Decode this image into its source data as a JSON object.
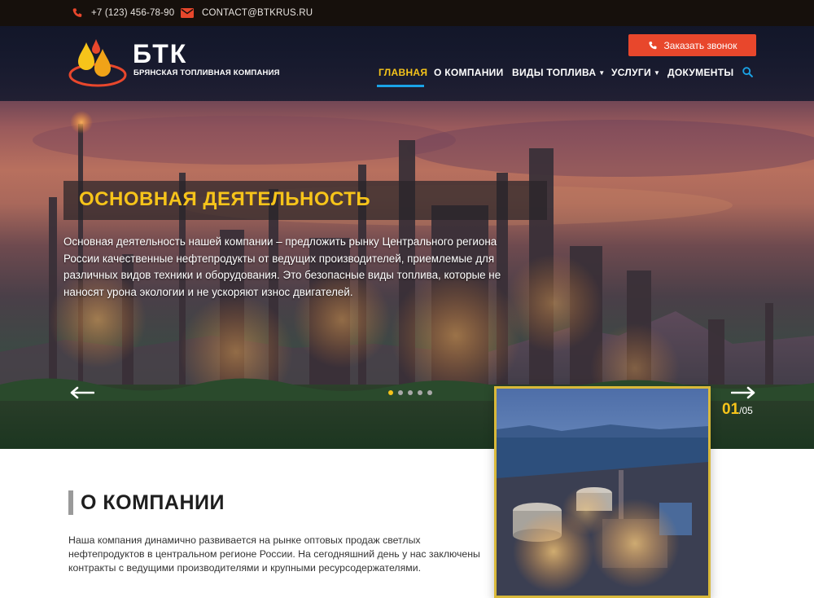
{
  "topbar": {
    "phone": "+7 (123) 456-78-90",
    "email": "CONTACT@BTKRUS.RU",
    "phone_icon": "phone-icon",
    "email_icon": "envelope-icon"
  },
  "header": {
    "logo_title": "БТК",
    "logo_subtitle": "Брянская топливная компания",
    "call_button": "Заказать звонок",
    "nav": [
      {
        "label": "ГЛАВНАЯ",
        "active": true
      },
      {
        "label": "О КОМПАНИИ"
      },
      {
        "label": "ВИДЫ ТОПЛИВА",
        "dropdown": true
      },
      {
        "label": "УСЛУГИ",
        "dropdown": true
      },
      {
        "label": "ДОКУМЕНТЫ"
      }
    ],
    "search_icon": "search-icon"
  },
  "slider": {
    "title": "ОСНОВНАЯ ДЕЯТЕЛЬНОСТЬ",
    "text": "Основная деятельность нашей компании – предложить рынку Центрального региона России качественные нефтепродукты от ведущих производителей, приемлемые для различных видов техники и оборудования. Это безопасные виды топлива, которые не наносят урона экологии и не ускоряют износ двигателей.",
    "current": "01",
    "total": "/05",
    "active_dot": 1,
    "dot_count": 5
  },
  "about": {
    "title": "О КОМПАНИИ",
    "text": "Наша компания динамично развивается на рынке оптовых продаж светлых нефтепродуктов в центральном регионе России. На сегодняшний день у нас заключены контракты с ведущими производителями и крупными ресурсодержателями."
  },
  "colors": {
    "accent_yellow": "#f6c41a",
    "button_red": "#e8472c",
    "active_underline": "#1aa3e6",
    "topbar_bg": "#16100c"
  }
}
